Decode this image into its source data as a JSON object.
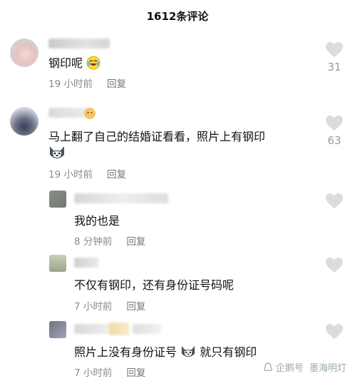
{
  "header": {
    "title": "1612条评论"
  },
  "comments": [
    {
      "text": "钢印呢",
      "time": "19 小时前",
      "reply": "回复",
      "likes": "31"
    },
    {
      "text": "马上翻了自己的结婚证看看，照片上有钢印",
      "time": "19 小时前",
      "reply": "回复",
      "likes": "63"
    },
    {
      "text": "我的也是",
      "time": "8 分钟前",
      "reply": "回复"
    },
    {
      "text": "不仅有钢印，还有身份证号码呢",
      "time": "7 小时前",
      "reply": "回复"
    },
    {
      "text_a": "照片上没有身份证号",
      "text_b": "就只有钢印",
      "time": "7 小时前",
      "reply": "回复"
    }
  ],
  "watermark": {
    "brand": "企鹅号",
    "author": "墨海明灯"
  },
  "icons": {
    "like": "heart-icon",
    "emoji_cry_laugh": "tears-of-joy-emoji",
    "emoji_dog": "husky-emoji",
    "brand": "penguin-logo-icon"
  },
  "colors": {
    "meta": "#8a8a8a",
    "heart": "#dcdcdc"
  }
}
